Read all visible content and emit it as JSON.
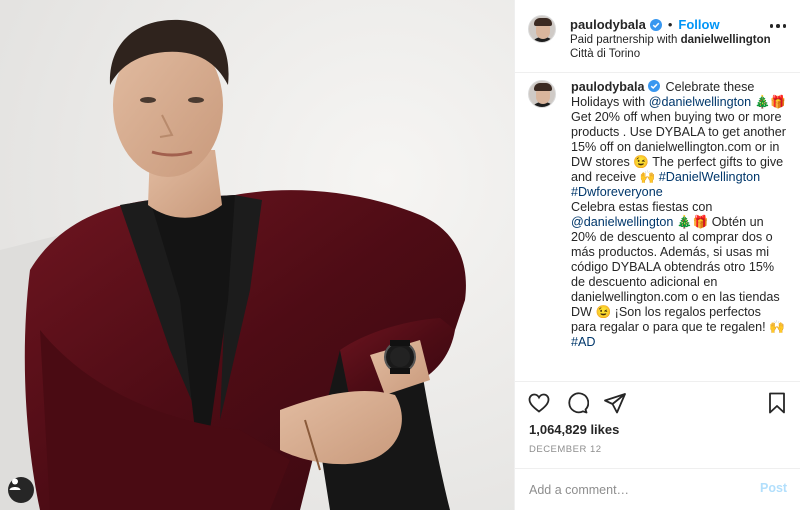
{
  "post": {
    "username": "paulodybala",
    "follow_label": "Follow",
    "dot": "•",
    "partnership_prefix": "Paid partnership with ",
    "partner": "danielwellington",
    "location": "Città di Torino",
    "caption_parts": [
      {
        "type": "text",
        "value": "Celebrate these Holidays with "
      },
      {
        "type": "link",
        "value": "@danielwellington"
      },
      {
        "type": "text",
        "value": " 🎄🎁 Get 20% off when buying two or more products . Use DYBALA to get another 15% off on danielwellington.com or in DW stores 😉 The perfect gifts to give and receive 🙌 "
      },
      {
        "type": "link",
        "value": "#DanielWellington"
      },
      {
        "type": "text",
        "value": " "
      },
      {
        "type": "link",
        "value": "#Dwforeveryone"
      },
      {
        "type": "text",
        "value": "\nCelebra estas fiestas con "
      },
      {
        "type": "link",
        "value": "@danielwellington"
      },
      {
        "type": "text",
        "value": " 🎄🎁 Obtén un 20% de descuento al comprar dos o más productos. Además, si usas mi código DYBALA obtendrás otro 15% de descuento adicional en danielwellington.com o en las tiendas DW 😉 ¡Son los regalos perfectos para regalar o para que te regalen! 🙌 "
      },
      {
        "type": "link",
        "value": "#AD"
      }
    ],
    "likes": "1,064,829 likes",
    "date": "DECEMBER 12"
  },
  "comment": {
    "placeholder": "Add a comment…",
    "post_label": "Post"
  },
  "icons": {
    "verified": "verified-badge-icon",
    "more": "more-options-icon",
    "like": "heart-icon",
    "comment": "comment-bubble-icon",
    "share": "paper-plane-icon",
    "save": "bookmark-icon",
    "tag": "user-tag-icon"
  },
  "colors": {
    "link": "#00376b",
    "follow": "#0095f6",
    "verified": "#3897f0",
    "post_disabled": "#b2dffc",
    "muted": "#8e8e8e",
    "jacket": "#5a1018"
  }
}
